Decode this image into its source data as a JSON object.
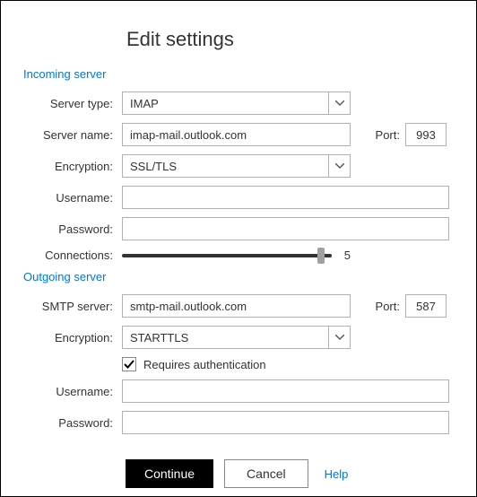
{
  "title": "Edit settings",
  "sections": {
    "incoming": "Incoming server",
    "outgoing": "Outgoing server"
  },
  "labels": {
    "server_type": "Server type:",
    "server_name": "Server name:",
    "port": "Port:",
    "encryption": "Encryption:",
    "username": "Username:",
    "password": "Password:",
    "connections": "Connections:",
    "smtp_server": "SMTP server:",
    "requires_auth": "Requires authentication"
  },
  "incoming": {
    "server_type": "IMAP",
    "server_name": "imap-mail.outlook.com",
    "port": "993",
    "encryption": "SSL/TLS",
    "username": "",
    "password": "",
    "connections": "5",
    "connections_percent": 95
  },
  "outgoing": {
    "smtp_server": "smtp-mail.outlook.com",
    "port": "587",
    "encryption": "STARTTLS",
    "requires_auth": true,
    "username": "",
    "password": ""
  },
  "buttons": {
    "continue": "Continue",
    "cancel": "Cancel",
    "help": "Help"
  }
}
